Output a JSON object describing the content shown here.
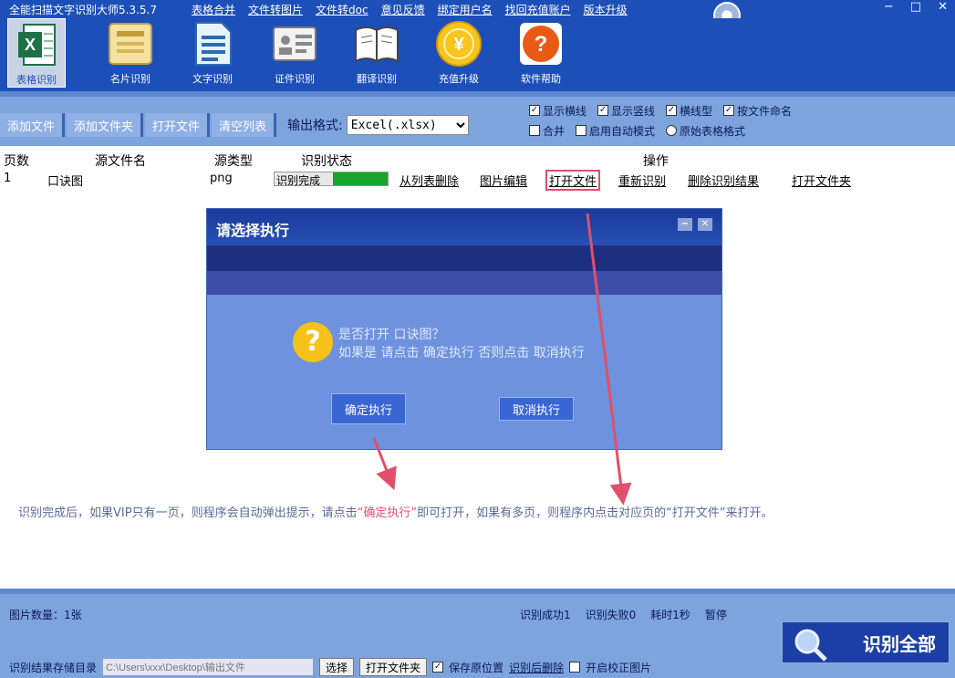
{
  "app": {
    "title": "全能扫描文字识别大师5.3.5.7",
    "menu": [
      "表格合并",
      "文件转图片",
      "文件转doc",
      "意见反馈",
      "绑定用户名",
      "找回充值账户",
      "版本升级"
    ],
    "window_controls": [
      "−",
      "□",
      "✕"
    ]
  },
  "toolbar": {
    "tools": [
      {
        "label": "表格识别",
        "icon": "excel-icon"
      },
      {
        "label": "名片识别",
        "icon": "card-icon"
      },
      {
        "label": "文字识别",
        "icon": "document-icon"
      },
      {
        "label": "证件识别",
        "icon": "id-card-icon"
      },
      {
        "label": "翻译识别",
        "icon": "book-icon"
      },
      {
        "label": "充值升级",
        "icon": "coin-icon"
      },
      {
        "label": "软件帮助",
        "icon": "help-icon"
      }
    ]
  },
  "subbar": {
    "buttons": [
      "添加文件",
      "添加文件夹",
      "打开文件",
      "清空列表"
    ],
    "output_label": "输出格式:",
    "output_format": "Excel(.xlsx)",
    "options_row1": [
      {
        "label": "显示横线",
        "checked": true
      },
      {
        "label": "显示竖线",
        "checked": true
      },
      {
        "label": "横线型",
        "checked": true
      },
      {
        "label": "按文件命名",
        "checked": true
      }
    ],
    "options_row2": [
      {
        "label": "合并",
        "type": "check",
        "checked": false
      },
      {
        "label": "启用自动模式",
        "type": "check",
        "checked": false
      },
      {
        "label": "原始表格格式",
        "type": "radio",
        "checked": false
      }
    ]
  },
  "table": {
    "headers": [
      "页数",
      "源文件名",
      "源类型",
      "识别状态",
      "操作"
    ],
    "rows": [
      {
        "page": "1",
        "name": "口诀图",
        "type": "png",
        "status": "识别完成",
        "progress": 1.0,
        "actions": [
          "从列表删除",
          "图片编辑",
          "打开文件",
          "重新识别",
          "删除识别结果",
          "打开文件夹"
        ]
      }
    ]
  },
  "dialog": {
    "title": "请选择执行",
    "controls": [
      "−",
      "✕"
    ],
    "icon": "?",
    "message_line1": "是否打开  口诀图？",
    "message_line2": "如果是 请点击 确定执行 否则点击 取消执行",
    "confirm": "确定执行",
    "cancel": "取消执行"
  },
  "note": {
    "text_a": "识别完成后，如果VIP只有一页，则程序会自动弹出提示，请点击",
    "highlight": "“确定执行”",
    "text_b": "即可打开，如果有多页，则程序内点击对应页的“打开文件”来打开。"
  },
  "footer": {
    "count": "图片数量：1张",
    "stats": [
      "识别成功1",
      "识别失败0",
      "耗时1秒",
      "暂停"
    ],
    "output_label": "识别结果存储目录",
    "output_path": "C:\\Users\\xxx\\Desktop\\输出文件",
    "browse": "选择",
    "open_folder": "打开文件夹",
    "chk_stay": "保存原位置",
    "chk_stay_checked": true,
    "link_text": "识别后删除",
    "chk_skip": "开启校正图片",
    "chk_skip_checked": false,
    "big_button": "识别全部"
  },
  "colors": {
    "header_blue": "#1d4fb9",
    "bar_blue": "#7ea4dd",
    "progress_green": "#14a52a",
    "highlight_red": "#e0506a",
    "dialog_blue": "#6e92dd"
  }
}
